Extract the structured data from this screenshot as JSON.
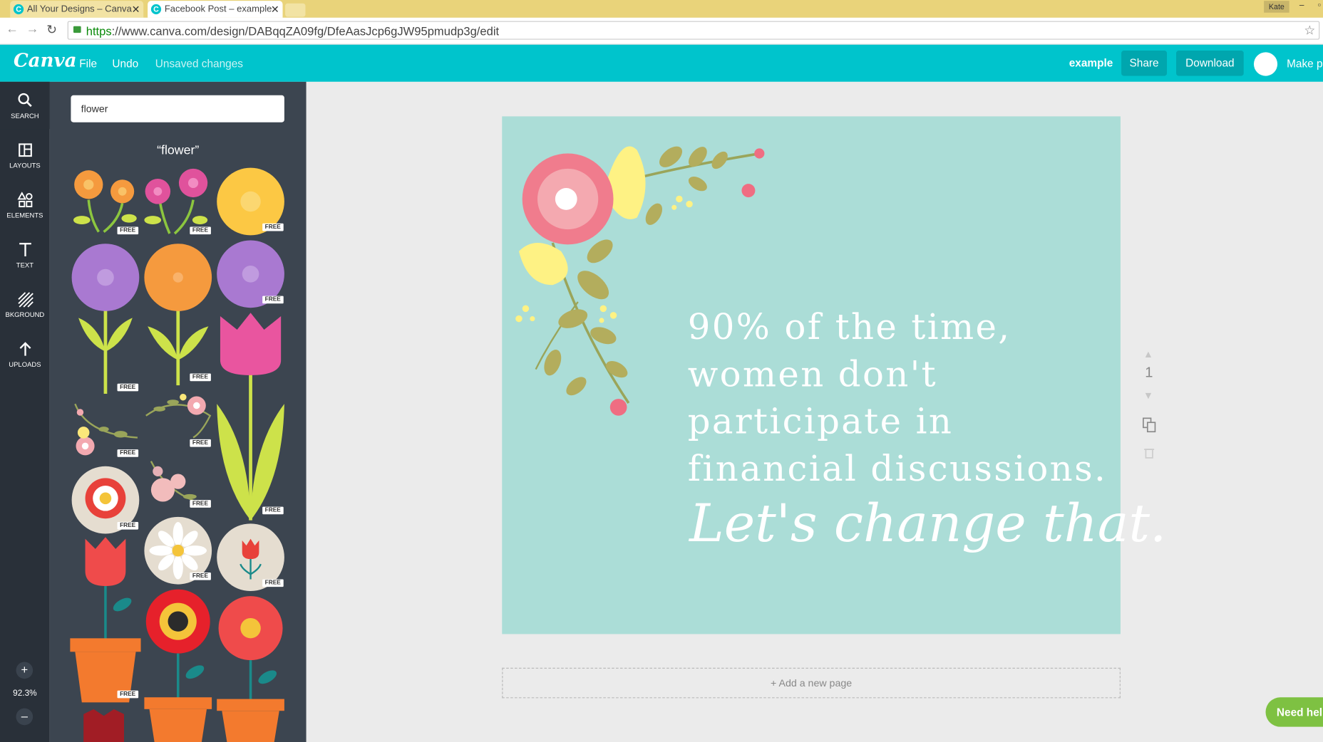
{
  "browser": {
    "tabs": [
      {
        "title": "All Your Designs – Canva",
        "active": false
      },
      {
        "title": "Facebook Post – example",
        "active": true
      }
    ],
    "user": "Kate",
    "url_scheme": "https",
    "url_rest": "://www.canva.com/design/DABqqZA09fg/DfeAasJcp6gJW95pmudp3g/edit"
  },
  "header": {
    "logo": "Canva",
    "file": "File",
    "undo": "Undo",
    "status": "Unsaved changes",
    "project_name": "example",
    "share": "Share",
    "download": "Download",
    "make_public": "Make pu",
    "color": "#00c4cc"
  },
  "rail": {
    "items": [
      {
        "label": "SEARCH",
        "icon": "search-icon"
      },
      {
        "label": "LAYOUTS",
        "icon": "layouts-icon"
      },
      {
        "label": "ELEMENTS",
        "icon": "elements-icon"
      },
      {
        "label": "TEXT",
        "icon": "text-icon"
      },
      {
        "label": "BKGROUND",
        "icon": "background-icon"
      },
      {
        "label": "UPLOADS",
        "icon": "uploads-icon"
      }
    ],
    "zoom_in": "+",
    "zoom_out": "–",
    "zoom": "92.3%"
  },
  "panel": {
    "search_value": "flower",
    "results_title": "“flower”",
    "free_badge": "FREE"
  },
  "design": {
    "quote": "90% of the time, women don't participate in financial discussions.",
    "cta": "Let's change that.",
    "background": "#abddd7"
  },
  "page_controls": {
    "page_number": "1"
  },
  "add_page": "+ Add a new page",
  "help": "Need help"
}
